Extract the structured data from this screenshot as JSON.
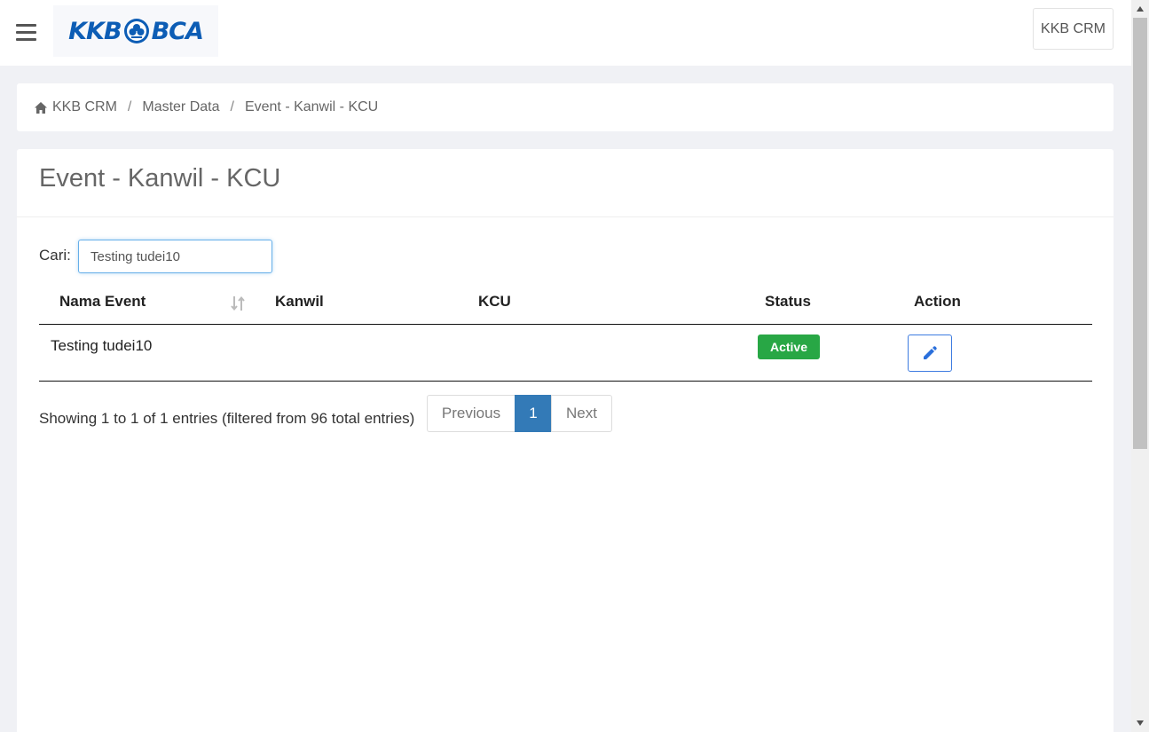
{
  "header": {
    "logo_text_left": "KKB",
    "logo_text_right": "BCA",
    "user_menu": "KKB CRM"
  },
  "breadcrumb": {
    "items": [
      "KKB CRM",
      "Master Data",
      "Event - Kanwil - KCU"
    ]
  },
  "page": {
    "title": "Event - Kanwil - KCU"
  },
  "search": {
    "label": "Cari:",
    "value": "Testing tudei10"
  },
  "table": {
    "columns": [
      "Nama Event",
      "Kanwil",
      "KCU",
      "Status",
      "Action"
    ],
    "rows": [
      {
        "nama_event": "Testing tudei10",
        "kanwil": "",
        "kcu": "",
        "status": "Active"
      }
    ]
  },
  "footer": {
    "info": "Showing 1 to 1 of 1 entries (filtered from 96 total entries)",
    "previous": "Previous",
    "page": "1",
    "next": "Next"
  },
  "colors": {
    "brand": "#0d5db5",
    "active_badge": "#28a745",
    "pagination_active": "#337ab7",
    "edit_button": "#3d7be0"
  },
  "icons": [
    "menu-icon",
    "home-icon",
    "sort-icon",
    "pencil-icon"
  ]
}
